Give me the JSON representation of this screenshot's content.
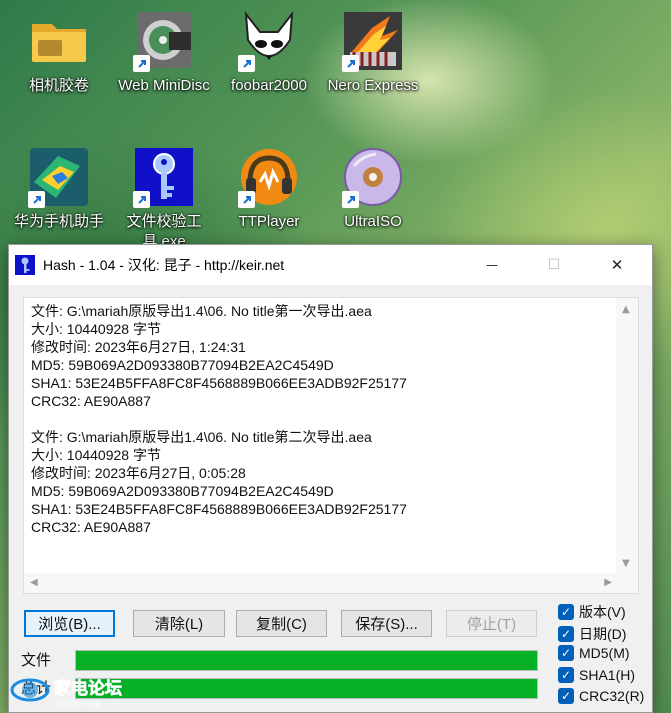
{
  "desktop": {
    "icons": [
      {
        "label": "相机胶卷",
        "icon": "folder-icon"
      },
      {
        "label": "Web MiniDisc",
        "icon": "minidisc-icon"
      },
      {
        "label": "foobar2000",
        "icon": "foobar-fox-icon"
      },
      {
        "label": "Nero Express",
        "icon": "nero-express-icon"
      },
      {
        "label": "华为手机助手",
        "icon": "huawei-assistant-icon"
      },
      {
        "label": "文件校验工具.exe",
        "icon": "key-icon"
      },
      {
        "label": "TTPlayer",
        "icon": "ttplayer-headphones-icon"
      },
      {
        "label": "UltraISO",
        "icon": "ultraiso-disc-icon"
      }
    ]
  },
  "window": {
    "title": "Hash - 1.04 - 汉化: 昆子 - http://keir.net",
    "controls": {
      "minimize": "—",
      "maximize": "☐",
      "close": "✕"
    },
    "output_lines": [
      "文件: G:\\mariah原版导出1.4\\06. No title第一次导出.aea",
      "大小: 10440928 字节",
      "修改时间: 2023年6月27日, 1:24:31",
      "MD5: 59B069A2D093380B77094B2EA2C4549D",
      "SHA1: 53E24B5FFA8FC8F4568889B066EE3ADB92F25177",
      "CRC32: AE90A887",
      "",
      "文件: G:\\mariah原版导出1.4\\06. No title第二次导出.aea",
      "大小: 10440928 字节",
      "修改时间: 2023年6月27日, 0:05:28",
      "MD5: 59B069A2D093380B77094B2EA2C4549D",
      "SHA1: 53E24B5FFA8FC8F4568889B066EE3ADB92F25177",
      "CRC32: AE90A887"
    ],
    "buttons": {
      "browse": "浏览(B)...",
      "clear": "清除(L)",
      "copy": "复制(C)",
      "save": "保存(S)...",
      "stop": "停止(T)"
    },
    "progress": {
      "file_label": "文件",
      "file_value": 1.0,
      "total_label": "总计",
      "total_value": 1.0,
      "fill_color": "#06b025"
    },
    "options": [
      {
        "label": "版本(V)",
        "checked": true
      },
      {
        "label": "日期(D)",
        "checked": true
      },
      {
        "label": "MD5(M)",
        "checked": true
      },
      {
        "label": "SHA1(H)",
        "checked": true
      },
      {
        "label": "CRC32(R)",
        "checked": true
      }
    ],
    "watermark": {
      "text": "家电论坛",
      "sub": "JDBBS.COM"
    }
  }
}
